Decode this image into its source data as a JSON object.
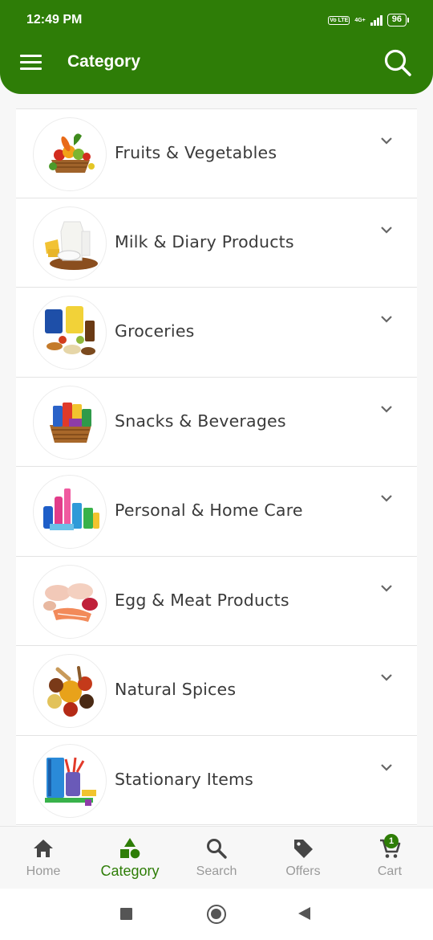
{
  "status_bar": {
    "time": "12:49 PM",
    "volte": "Vo LTE",
    "network": "4G+",
    "battery": "96"
  },
  "header": {
    "title": "Category",
    "menu_icon": "hamburger-menu-icon",
    "search_icon": "search-icon",
    "background_color": "#2e7d07"
  },
  "categories": [
    {
      "label": "Fruits & Vegetables",
      "icon": "fruits-vegetables-image"
    },
    {
      "label": "Milk & Diary Products",
      "icon": "milk-dairy-image"
    },
    {
      "label": "Groceries",
      "icon": "groceries-image"
    },
    {
      "label": "Snacks & Beverages",
      "icon": "snacks-basket-image"
    },
    {
      "label": "Personal & Home Care",
      "icon": "home-care-products-image"
    },
    {
      "label": "Egg & Meat Products",
      "icon": "meat-products-image"
    },
    {
      "label": "Natural Spices",
      "icon": "spices-image"
    },
    {
      "label": "Stationary Items",
      "icon": "stationery-image"
    }
  ],
  "bottom_nav": {
    "active_color": "#2e7d07",
    "inactive_color": "#9a9a9a",
    "items": [
      {
        "label": "Home",
        "icon": "home-icon"
      },
      {
        "label": "Category",
        "icon": "shapes-icon"
      },
      {
        "label": "Search",
        "icon": "search-icon"
      },
      {
        "label": "Offers",
        "icon": "tag-icon"
      },
      {
        "label": "Cart",
        "icon": "cart-icon",
        "badge": "1"
      }
    ],
    "active": "Category"
  }
}
